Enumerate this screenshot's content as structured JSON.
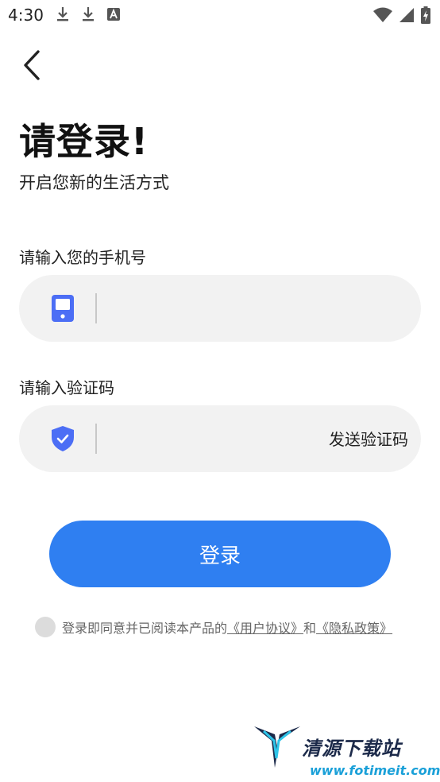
{
  "status_bar": {
    "time": "4:30",
    "left_icons": [
      "download-icon",
      "download-icon",
      "text-a-icon"
    ],
    "right_icons": [
      "wifi-icon",
      "signal-icon",
      "battery-charging-icon"
    ]
  },
  "header": {
    "back_icon": "chevron-left-icon",
    "title": "请登录!",
    "subtitle": "开启您新的生活方式"
  },
  "phone_field": {
    "label": "请输入您的手机号",
    "icon": "phone-icon",
    "value": "",
    "placeholder": ""
  },
  "code_field": {
    "label": "请输入验证码",
    "icon": "shield-check-icon",
    "value": "",
    "placeholder": "",
    "send_code_label": "发送验证码"
  },
  "login_button_label": "登录",
  "agreement": {
    "checked": false,
    "prefix": "登录即同意并已阅读本产品的",
    "user_agreement": "《用户协议》",
    "and": "和",
    "privacy_policy": "《隐私政策》"
  },
  "watermark": {
    "title": "清源下载站",
    "url": "www.fotimeit.com"
  },
  "colors": {
    "accent": "#2f7ff1",
    "icon_blue": "#4c6ef5",
    "input_bg": "#f2f2f2",
    "page_bg": "#ffffff"
  }
}
